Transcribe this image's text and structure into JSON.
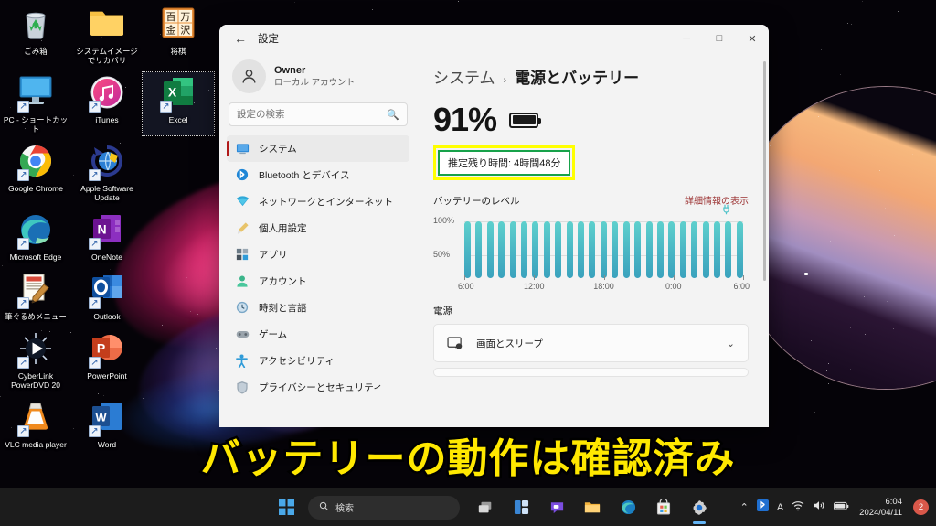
{
  "desktop": {
    "icons": [
      {
        "label": "ごみ箱",
        "icon": "recycle-bin-icon",
        "shortcut": false,
        "selected": false
      },
      {
        "label": "システムイメージでリカバリ",
        "icon": "folder-icon",
        "shortcut": false,
        "selected": false
      },
      {
        "label": "将棋",
        "icon": "shogi-icon",
        "shortcut": false,
        "selected": false
      },
      {
        "label": "PC - ショートカット",
        "icon": "monitor-icon",
        "shortcut": true,
        "selected": false
      },
      {
        "label": "iTunes",
        "icon": "itunes-icon",
        "shortcut": true,
        "selected": false
      },
      {
        "label": "Excel",
        "icon": "excel-icon",
        "shortcut": true,
        "selected": true
      },
      {
        "label": "Google Chrome",
        "icon": "chrome-icon",
        "shortcut": true,
        "selected": false
      },
      {
        "label": "Apple Software Update",
        "icon": "apple-update-icon",
        "shortcut": true,
        "selected": false
      },
      {
        "label": "",
        "icon": "none",
        "shortcut": false,
        "selected": false
      },
      {
        "label": "Microsoft Edge",
        "icon": "edge-icon",
        "shortcut": true,
        "selected": false
      },
      {
        "label": "OneNote",
        "icon": "onenote-icon",
        "shortcut": true,
        "selected": false
      },
      {
        "label": "",
        "icon": "none",
        "shortcut": false,
        "selected": false
      },
      {
        "label": "筆ぐるめメニュー",
        "icon": "fudegurume-icon",
        "shortcut": true,
        "selected": false
      },
      {
        "label": "Outlook",
        "icon": "outlook-icon",
        "shortcut": true,
        "selected": false
      },
      {
        "label": "",
        "icon": "none",
        "shortcut": false,
        "selected": false
      },
      {
        "label": "CyberLink PowerDVD 20",
        "icon": "powerdvd-icon",
        "shortcut": true,
        "selected": false
      },
      {
        "label": "PowerPoint",
        "icon": "powerpoint-icon",
        "shortcut": true,
        "selected": false
      },
      {
        "label": "",
        "icon": "none",
        "shortcut": false,
        "selected": false
      },
      {
        "label": "VLC media player",
        "icon": "vlc-icon",
        "shortcut": true,
        "selected": false
      },
      {
        "label": "Word",
        "icon": "word-icon",
        "shortcut": true,
        "selected": false
      },
      {
        "label": "",
        "icon": "none",
        "shortcut": false,
        "selected": false
      }
    ]
  },
  "window": {
    "title": "設定",
    "back_icon": "back-arrow-icon",
    "controls": {
      "minimize": "─",
      "maximize": "□",
      "close": "✕"
    }
  },
  "sidebar": {
    "account": {
      "name": "Owner",
      "type": "ローカル アカウント",
      "avatar_icon": "person-avatar-icon"
    },
    "search": {
      "placeholder": "設定の検索",
      "icon": "search-icon"
    },
    "items": [
      {
        "label": "システム",
        "icon": "system-monitor-icon",
        "active": true
      },
      {
        "label": "Bluetooth とデバイス",
        "icon": "bluetooth-icon",
        "active": false
      },
      {
        "label": "ネットワークとインターネット",
        "icon": "network-icon",
        "active": false
      },
      {
        "label": "個人用設定",
        "icon": "personalization-brush-icon",
        "active": false
      },
      {
        "label": "アプリ",
        "icon": "apps-icon",
        "active": false
      },
      {
        "label": "アカウント",
        "icon": "account-person-icon",
        "active": false
      },
      {
        "label": "時刻と言語",
        "icon": "clock-icon",
        "active": false
      },
      {
        "label": "ゲーム",
        "icon": "gamepad-icon",
        "active": false
      },
      {
        "label": "アクセシビリティ",
        "icon": "accessibility-icon",
        "active": false
      },
      {
        "label": "プライバシーとセキュリティ",
        "icon": "shield-icon",
        "active": false
      }
    ]
  },
  "content": {
    "breadcrumb": {
      "parent": "システム",
      "separator": "›",
      "current": "電源とバッテリー"
    },
    "battery": {
      "percent": "91%",
      "icon": "battery-full-icon",
      "remaining_label": "推定残り時間: 4時間48分",
      "highlight_outer_color": "#ffff00",
      "highlight_inner_color": "#17a24a"
    },
    "chart_section": {
      "title": "バッテリーのレベル",
      "detail_link": "詳細情報の表示",
      "detail_link_color": "#9b3131",
      "plug_icon": "power-plug-icon"
    },
    "power_section": {
      "heading": "電源",
      "cards": [
        {
          "label": "画面とスリープ",
          "icon": "screen-sleep-icon",
          "chevron": "⌄"
        }
      ]
    }
  },
  "chart_data": {
    "type": "bar",
    "title": "バッテリーのレベル",
    "xlabel": "",
    "ylabel": "",
    "ylim": [
      0,
      100
    ],
    "ytick_labels": [
      "100%",
      "50%"
    ],
    "ytick_values": [
      100,
      50
    ],
    "grid": true,
    "legend": false,
    "bar_color": "#49b5c4",
    "x_tick_labels": [
      "6:00",
      "12:00",
      "18:00",
      "0:00",
      "6:00"
    ],
    "x_tick_positions": [
      0,
      25,
      50,
      75,
      100
    ],
    "categories": [
      "6:00",
      "7:00",
      "8:00",
      "9:00",
      "10:00",
      "11:00",
      "12:00",
      "13:00",
      "14:00",
      "15:00",
      "16:00",
      "17:00",
      "18:00",
      "19:00",
      "20:00",
      "21:00",
      "22:00",
      "23:00",
      "0:00",
      "1:00",
      "2:00",
      "3:00",
      "4:00",
      "5:00",
      "6:00"
    ],
    "values": [
      100,
      100,
      100,
      100,
      100,
      100,
      100,
      100,
      100,
      100,
      100,
      100,
      100,
      100,
      100,
      100,
      100,
      100,
      100,
      100,
      100,
      100,
      100,
      100,
      100
    ]
  },
  "caption": {
    "text": "バッテリーの動作は確認済み",
    "color": "#ffe800",
    "outline_color": "#000000"
  },
  "taskbar": {
    "start_icon": "windows-start-icon",
    "search": {
      "text": "検索",
      "icon": "search-icon"
    },
    "buttons": [
      {
        "name": "task-view-icon",
        "active": false
      },
      {
        "name": "widgets-icon",
        "active": false
      },
      {
        "name": "chat-icon",
        "active": false
      },
      {
        "name": "file-explorer-icon",
        "active": false
      },
      {
        "name": "edge-icon",
        "active": false
      },
      {
        "name": "microsoft-store-icon",
        "active": false
      },
      {
        "name": "settings-gear-icon",
        "active": true
      }
    ],
    "tray": {
      "chevron": "⌃",
      "bluetooth_icon": "bluetooth-icon",
      "ime_label": "A",
      "wifi_icon": "wifi-icon",
      "volume_icon": "volume-icon",
      "battery_icon": "battery-icon",
      "time": "6:04",
      "date": "2024/04/11",
      "notification_count": "2"
    }
  }
}
